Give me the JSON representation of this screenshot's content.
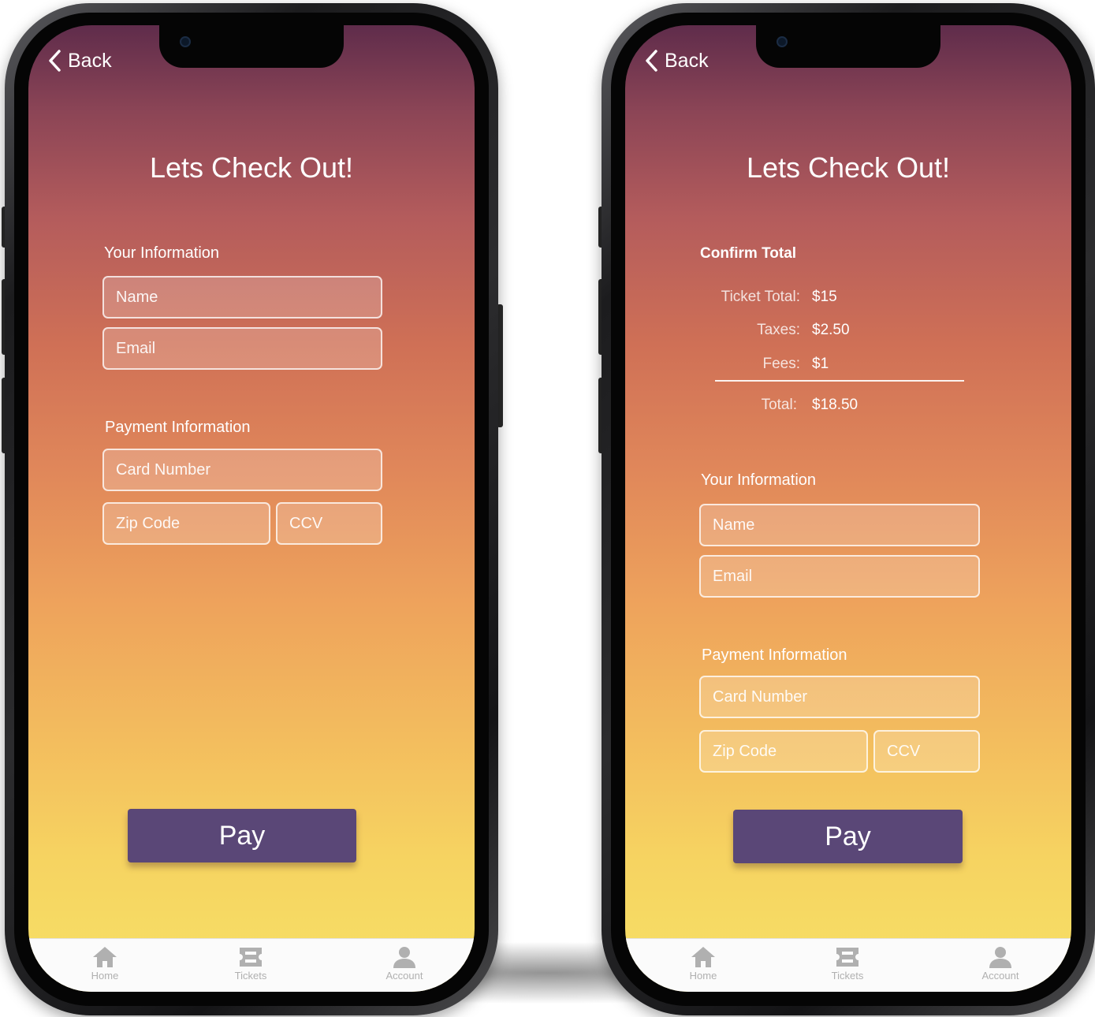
{
  "screens": [
    {
      "back_label": "Back",
      "title": "Lets Check Out!",
      "your_info_label": "Your Information",
      "name_placeholder": "Name",
      "email_placeholder": "Email",
      "payment_info_label": "Payment Information",
      "card_placeholder": "Card Number",
      "zip_placeholder": "Zip Code",
      "ccv_placeholder": "CCV",
      "pay_label": "Pay"
    },
    {
      "back_label": "Back",
      "title": "Lets Check Out!",
      "confirm_total_label": "Confirm Total",
      "ticket_total_label": "Ticket Total:",
      "ticket_total_value": "$15",
      "taxes_label": "Taxes:",
      "taxes_value": "$2.50",
      "fees_label": "Fees:",
      "fees_value": "$1",
      "total_label": "Total:",
      "total_value": "$18.50",
      "your_info_label": "Your Information",
      "name_placeholder": "Name",
      "email_placeholder": "Email",
      "payment_info_label": "Payment Information",
      "card_placeholder": "Card Number",
      "zip_placeholder": "Zip Code",
      "ccv_placeholder": "CCV",
      "pay_label": "Pay"
    }
  ],
  "tabbar": {
    "items": [
      {
        "label": "Home",
        "icon": "home-icon"
      },
      {
        "label": "Tickets",
        "icon": "ticket-icon"
      },
      {
        "label": "Account",
        "icon": "account-icon"
      }
    ]
  },
  "colors": {
    "gradient_top": "#5f2c4b",
    "gradient_mid": "#e0875a",
    "gradient_bottom": "#f7e166",
    "pay_button": "#5a4777",
    "tab_icon": "#b0b0b0"
  }
}
